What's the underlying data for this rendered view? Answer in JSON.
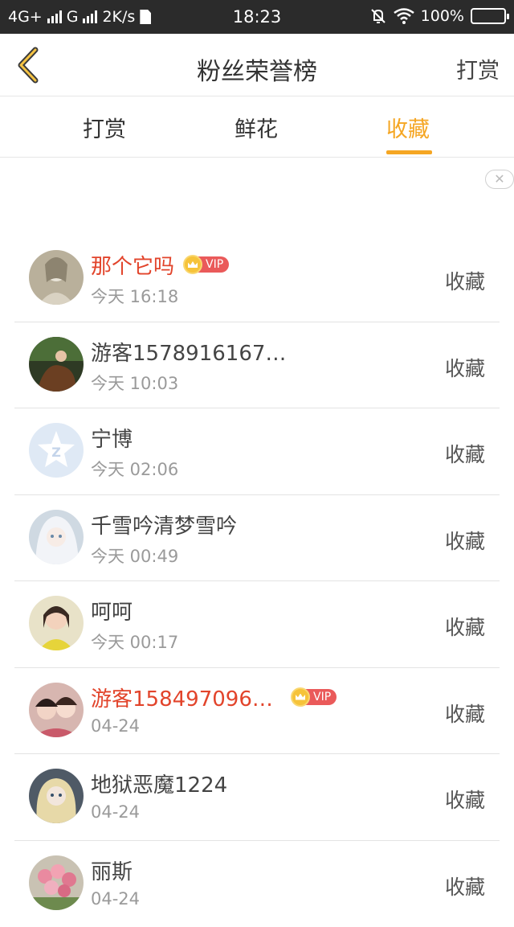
{
  "status_bar": {
    "network": "4G+",
    "network2": "G",
    "speed": "2K/s",
    "time": "18:23",
    "battery": "100%"
  },
  "header": {
    "title": "粉丝荣誉榜",
    "action_label": "打赏"
  },
  "tabs": [
    {
      "label": "打赏",
      "active": false
    },
    {
      "label": "鲜花",
      "active": false
    },
    {
      "label": "收藏",
      "active": true
    }
  ],
  "ad_close": "✕",
  "vip_label": "VIP",
  "list": [
    {
      "name": "那个它吗",
      "time": "今天 16:18",
      "action": "收藏",
      "vip": true
    },
    {
      "name": "游客1578916167…",
      "time": "今天 10:03",
      "action": "收藏",
      "vip": false
    },
    {
      "name": "宁博",
      "time": "今天 02:06",
      "action": "收藏",
      "vip": false
    },
    {
      "name": "千雪吟清梦雪吟",
      "time": "今天 00:49",
      "action": "收藏",
      "vip": false
    },
    {
      "name": "呵呵",
      "time": "今天 00:17",
      "action": "收藏",
      "vip": false
    },
    {
      "name": "游客158497096…",
      "time": "04-24",
      "action": "收藏",
      "vip": true
    },
    {
      "name": "地狱恶魔1224",
      "time": "04-24",
      "action": "收藏",
      "vip": false
    },
    {
      "name": "丽斯",
      "time": "04-24",
      "action": "收藏",
      "vip": false
    }
  ],
  "colors": {
    "accent": "#f5a623",
    "vip_name": "#e2442b",
    "vip_tag": "#ea5a5a"
  }
}
